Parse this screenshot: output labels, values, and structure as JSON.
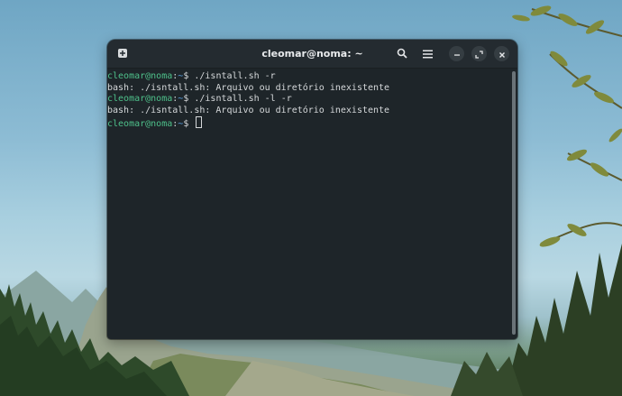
{
  "window": {
    "title": "cleomar@noma: ~"
  },
  "icons": {
    "new_tab": "new-tab-icon",
    "search": "search-icon",
    "menu": "hamburger-menu-icon",
    "minimize": "minimize-icon",
    "maximize": "maximize-icon",
    "close": "close-icon"
  },
  "terminal": {
    "lines": [
      {
        "user": "cleomar@noma",
        "path": "~",
        "prompt": "$",
        "text": " ./isntall.sh -r"
      },
      {
        "text": "bash: ./isntall.sh: Arquivo ou diretório inexistente"
      },
      {
        "user": "cleomar@noma",
        "path": "~",
        "prompt": "$",
        "text": " ./isntall.sh -l -r"
      },
      {
        "text": "bash: ./isntall.sh: Arquivo ou diretório inexistente"
      },
      {
        "user": "cleomar@noma",
        "path": "~",
        "prompt": "$",
        "text": " "
      }
    ]
  },
  "colors": {
    "terminal_bg": "#1e2529",
    "user_color": "#4ec08a",
    "path_color": "#5aa4e6",
    "text_color": "#d5d8da"
  }
}
